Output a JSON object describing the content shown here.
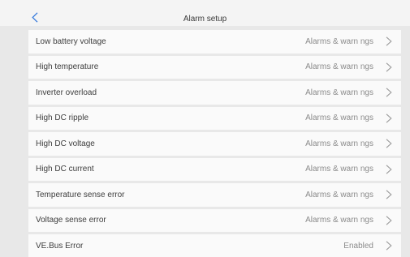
{
  "header": {
    "title": "Alarm setup",
    "back_icon": "chevron-left-icon"
  },
  "colors": {
    "accent": "#3b7ddd",
    "background": "#e8e8e8",
    "row": "#fafafa"
  },
  "items": [
    {
      "label": "Low battery voltage",
      "value": "Alarms & warn ngs"
    },
    {
      "label": "High temperature",
      "value": "Alarms & warn ngs"
    },
    {
      "label": "Inverter overload",
      "value": "Alarms & warn ngs"
    },
    {
      "label": "High DC ripple",
      "value": "Alarms & warn ngs"
    },
    {
      "label": "High DC voltage",
      "value": "Alarms & warn ngs"
    },
    {
      "label": "High DC current",
      "value": "Alarms & warn ngs"
    },
    {
      "label": "Temperature sense error",
      "value": "Alarms & warn ngs"
    },
    {
      "label": "Voltage sense error",
      "value": "Alarms & warn ngs"
    },
    {
      "label": "VE.Bus Error",
      "value": "Enabled"
    }
  ]
}
